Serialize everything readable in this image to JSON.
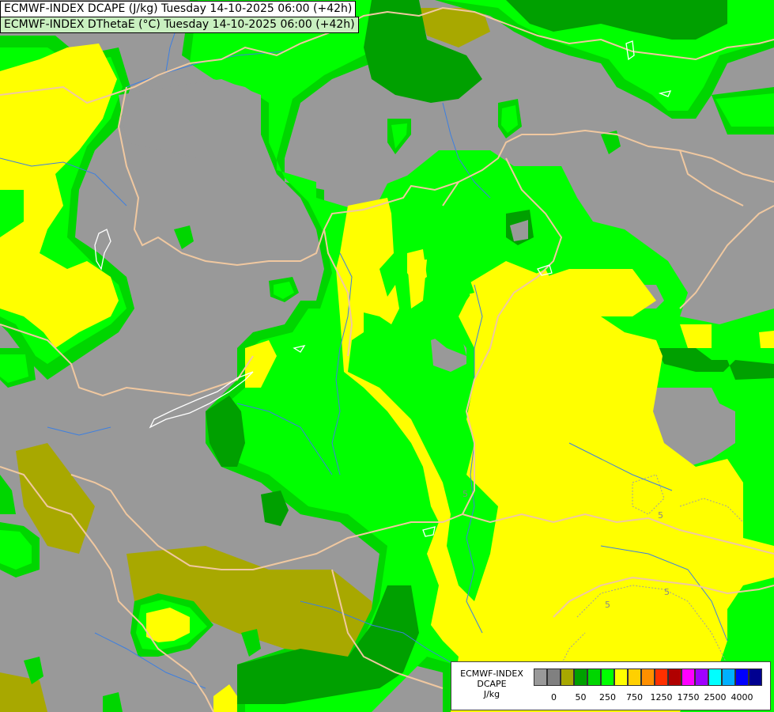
{
  "title": {
    "line1": "ECMWF-INDEX DCAPE (J/kg) Tuesday 14-10-2025 06:00 (+42h)",
    "line2": "ECMWF-INDEX DThetaE (°C) Tuesday 14-10-2025 06:00 (+42h)"
  },
  "colors": {
    "background": "#999999",
    "olive": "#a8a800",
    "dark_green": "#00a000",
    "green": "#00d600",
    "light_green": "#00ff00",
    "yellow": "#ffff00",
    "border": "#f0c8a0",
    "river": "#3d7fe0",
    "lake": "#ffffff",
    "contour": "#b0b0b0"
  },
  "legend": {
    "line1": "ECMWF-INDEX",
    "line2": "DCAPE",
    "line3": "J/kg",
    "colors": [
      "#999999",
      "#808080",
      "#a8a800",
      "#00a000",
      "#00d600",
      "#00ff00",
      "#ffff00",
      "#ffd000",
      "#ff9000",
      "#ff3000",
      "#b00000",
      "#ff00ff",
      "#a000ff",
      "#00ffff",
      "#00b0ff",
      "#0000ff",
      "#000090"
    ],
    "ticks": [
      {
        "label": "0",
        "index": 1
      },
      {
        "label": "50",
        "index": 3
      },
      {
        "label": "250",
        "index": 5
      },
      {
        "label": "750",
        "index": 7
      },
      {
        "label": "1250",
        "index": 9
      },
      {
        "label": "1750",
        "index": 11
      },
      {
        "label": "2500",
        "index": 13
      },
      {
        "label": "4000",
        "index": 15
      }
    ]
  },
  "contour_labels": [
    "5",
    "5",
    "5",
    "5"
  ]
}
